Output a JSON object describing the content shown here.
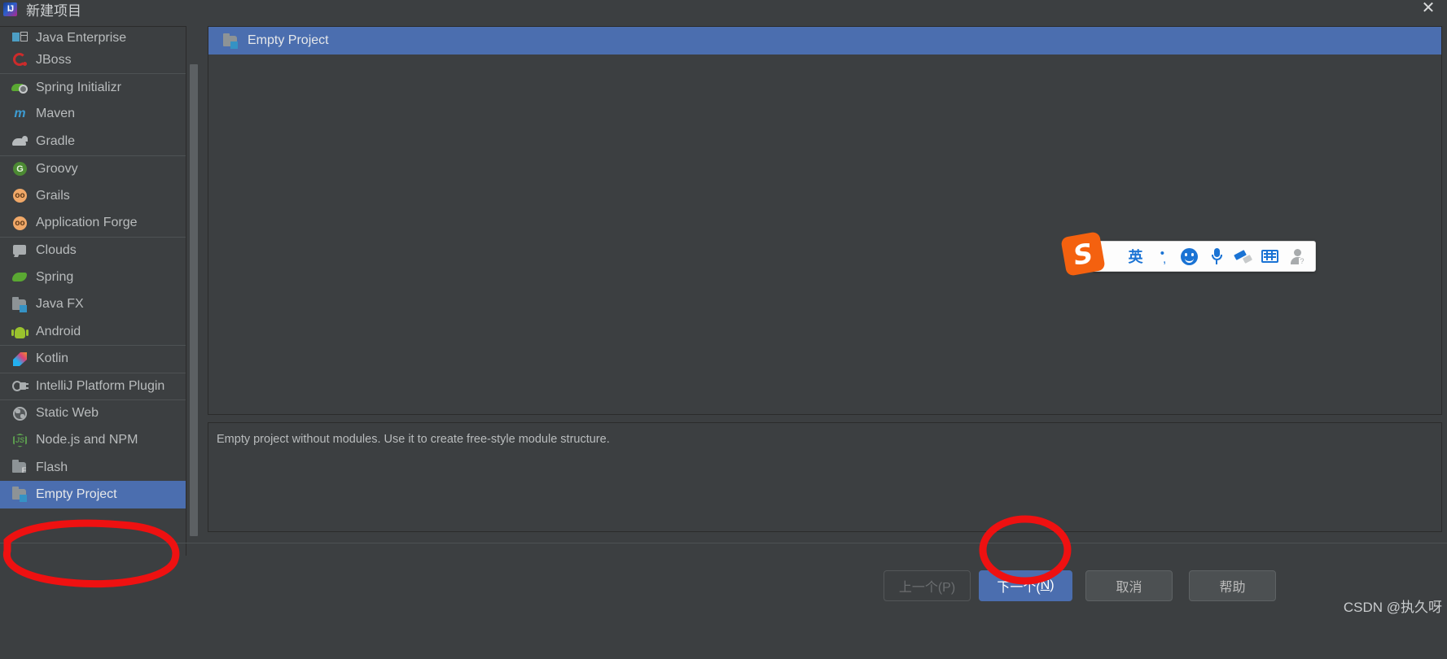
{
  "window": {
    "title": "新建项目",
    "app_icon": "intellij-idea-icon",
    "close_label": "✕"
  },
  "sidebar": {
    "scroll": {
      "name": "list-scrollbar"
    },
    "items": [
      {
        "label": "Java Enterprise",
        "icon": "java-enterprise-icon",
        "separator_above": false,
        "selected": false,
        "partial_top": true
      },
      {
        "label": "JBoss",
        "icon": "jboss-icon",
        "separator_above": false,
        "selected": false
      },
      {
        "label": "Spring Initializr",
        "icon": "spring-initializr-icon",
        "separator_above": true,
        "selected": false
      },
      {
        "label": "Maven",
        "icon": "maven-icon",
        "separator_above": false,
        "selected": false
      },
      {
        "label": "Gradle",
        "icon": "gradle-icon",
        "separator_above": false,
        "selected": false
      },
      {
        "label": "Groovy",
        "icon": "groovy-icon",
        "separator_above": true,
        "selected": false
      },
      {
        "label": "Grails",
        "icon": "grails-icon",
        "separator_above": false,
        "selected": false
      },
      {
        "label": "Application Forge",
        "icon": "application-forge-icon",
        "separator_above": false,
        "selected": false
      },
      {
        "label": "Clouds",
        "icon": "clouds-icon",
        "separator_above": true,
        "selected": false
      },
      {
        "label": "Spring",
        "icon": "spring-icon",
        "separator_above": false,
        "selected": false
      },
      {
        "label": "Java FX",
        "icon": "javafx-icon",
        "separator_above": false,
        "selected": false
      },
      {
        "label": "Android",
        "icon": "android-icon",
        "separator_above": false,
        "selected": false
      },
      {
        "label": "Kotlin",
        "icon": "kotlin-icon",
        "separator_above": true,
        "selected": false
      },
      {
        "label": "IntelliJ Platform Plugin",
        "icon": "intellij-plugin-icon",
        "separator_above": true,
        "selected": false
      },
      {
        "label": "Static Web",
        "icon": "static-web-icon",
        "separator_above": true,
        "selected": false
      },
      {
        "label": "Node.js and NPM",
        "icon": "nodejs-icon",
        "separator_above": false,
        "selected": false
      },
      {
        "label": "Flash",
        "icon": "flash-icon",
        "separator_above": false,
        "selected": false
      },
      {
        "label": "Empty Project",
        "icon": "empty-project-icon",
        "separator_above": false,
        "selected": true
      }
    ]
  },
  "main": {
    "header": {
      "title": "Empty Project",
      "icon": "empty-project-icon"
    },
    "description": "Empty project without modules. Use it to create free-style module structure."
  },
  "footer": {
    "previous_label": "上一个(P)",
    "next_label_prefix": "下一个(",
    "next_mnemonic": "N",
    "next_label_suffix": ")",
    "cancel_label": "取消",
    "help_label": "帮助",
    "watermark": "CSDN @执久呀"
  },
  "ime": {
    "logo": "sogou-logo",
    "items": [
      {
        "name": "language-mode",
        "glyph": "英",
        "style": "cn"
      },
      {
        "name": "punctuation-toggle",
        "glyph": "·,",
        "style": ""
      },
      {
        "name": "emoji-icon",
        "glyph": "☻",
        "style": ""
      },
      {
        "name": "voice-input-icon",
        "glyph": "⬤",
        "style": ""
      },
      {
        "name": "handwriting-icon",
        "glyph": "✎",
        "style": ""
      },
      {
        "name": "soft-keyboard-icon",
        "glyph": "⌨",
        "style": ""
      },
      {
        "name": "user-account-icon",
        "glyph": "⬤",
        "style": "gray"
      }
    ]
  },
  "annotations": {
    "ellipse_sidebar": "red-ellipse-empty-project",
    "ellipse_next": "red-ellipse-next-button"
  },
  "colors": {
    "accent_blue": "#4b6eaf",
    "background": "#3c3f41",
    "annotation_red": "#ee1111"
  }
}
